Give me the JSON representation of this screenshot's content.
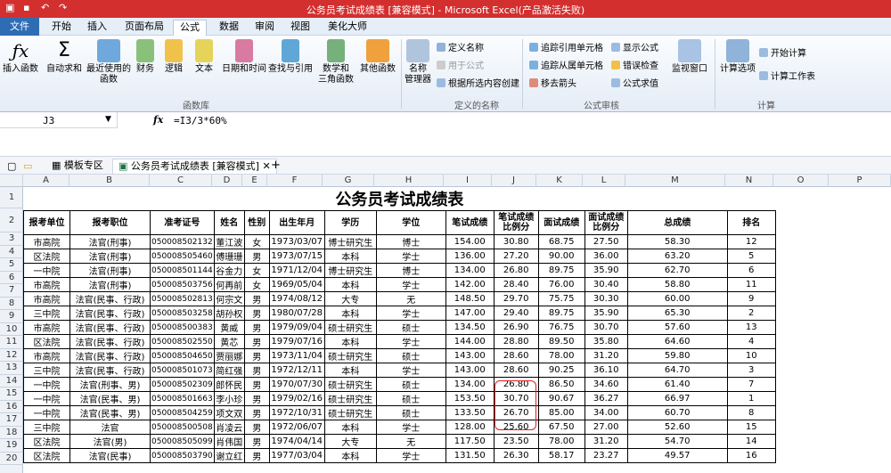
{
  "window": {
    "title": "公务员考试成绩表 [兼容模式] - Microsoft Excel(产品激活失败)"
  },
  "tabs": [
    "文件",
    "开始",
    "插入",
    "页面布局",
    "公式",
    "数据",
    "审阅",
    "视图",
    "美化大师"
  ],
  "ribbon": {
    "big": [
      "插入函数",
      "自动求和",
      "最近使用的\n函数",
      "财务",
      "逻辑",
      "文本",
      "日期和时间",
      "查找与引用",
      "数学和\n三角函数",
      "其他函数",
      "名称\n管理器",
      "监视窗口",
      "计算选项"
    ],
    "group_labels": [
      "函数库",
      "定义的名称",
      "公式审核",
      "计算"
    ],
    "small": [
      "定义名称",
      "用于公式",
      "根据所选内容创建",
      "追踪引用单元格",
      "追踪从属单元格",
      "移去箭头",
      "显示公式",
      "错误检查",
      "公式求值",
      "开始计算",
      "计算工作表"
    ]
  },
  "formula_bar": {
    "cell": "J3",
    "fx": "fx",
    "formula": "=I3/3*60%"
  },
  "doc_tabs": [
    "模板专区",
    "公务员考试成绩表 [兼容模式]"
  ],
  "columns": [
    "A",
    "B",
    "C",
    "D",
    "E",
    "F",
    "G",
    "H",
    "I",
    "J",
    "K",
    "L",
    "M",
    "N",
    "O",
    "P"
  ],
  "rows": [
    "1",
    "2",
    "3",
    "4",
    "5",
    "6",
    "7",
    "8",
    "9",
    "10",
    "11",
    "12",
    "13",
    "14",
    "15",
    "16",
    "17",
    "18",
    "19",
    "20"
  ],
  "sheet": {
    "title": "公务员考试成绩表",
    "headers": [
      "报考单位",
      "报考职位",
      "准考证号",
      "姓名",
      "性别",
      "出生年月",
      "学历",
      "学位",
      "笔试成绩",
      "笔试成绩比例分",
      "面试成绩",
      "面试成绩比例分",
      "总成绩",
      "排名"
    ],
    "data": [
      [
        "市高院",
        "法官(刑事)",
        "050008502132",
        "董江波",
        "女",
        "1973/03/07",
        "博士研究生",
        "博士",
        "154.00",
        "30.80",
        "68.75",
        "27.50",
        "58.30",
        "12"
      ],
      [
        "区法院",
        "法官(刑事)",
        "050008505460",
        "傅珊珊",
        "男",
        "1973/07/15",
        "本科",
        "学士",
        "136.00",
        "27.20",
        "90.00",
        "36.00",
        "63.20",
        "5"
      ],
      [
        "一中院",
        "法官(刑事)",
        "050008501144",
        "谷金力",
        "女",
        "1971/12/04",
        "博士研究生",
        "博士",
        "134.00",
        "26.80",
        "89.75",
        "35.90",
        "62.70",
        "6"
      ],
      [
        "市高院",
        "法官(刑事)",
        "050008503756",
        "何再前",
        "女",
        "1969/05/04",
        "本科",
        "学士",
        "142.00",
        "28.40",
        "76.00",
        "30.40",
        "58.80",
        "11"
      ],
      [
        "市高院",
        "法官(民事、行政)",
        "050008502813",
        "何宗文",
        "男",
        "1974/08/12",
        "大专",
        "无",
        "148.50",
        "29.70",
        "75.75",
        "30.30",
        "60.00",
        "9"
      ],
      [
        "三中院",
        "法官(民事、行政)",
        "050008503258",
        "胡孙权",
        "男",
        "1980/07/28",
        "本科",
        "学士",
        "147.00",
        "29.40",
        "89.75",
        "35.90",
        "65.30",
        "2"
      ],
      [
        "市高院",
        "法官(民事、行政)",
        "050008500383",
        "黄威",
        "男",
        "1979/09/04",
        "硕士研究生",
        "硕士",
        "134.50",
        "26.90",
        "76.75",
        "30.70",
        "57.60",
        "13"
      ],
      [
        "区法院",
        "法官(民事、行政)",
        "050008502550",
        "黄芯",
        "男",
        "1979/07/16",
        "本科",
        "学士",
        "144.00",
        "28.80",
        "89.50",
        "35.80",
        "64.60",
        "4"
      ],
      [
        "市高院",
        "法官(民事、行政)",
        "050008504650",
        "贾丽娜",
        "男",
        "1973/11/04",
        "硕士研究生",
        "硕士",
        "143.00",
        "28.60",
        "78.00",
        "31.20",
        "59.80",
        "10"
      ],
      [
        "三中院",
        "法官(民事、行政)",
        "050008501073",
        "简红强",
        "男",
        "1972/12/11",
        "本科",
        "学士",
        "143.00",
        "28.60",
        "90.25",
        "36.10",
        "64.70",
        "3"
      ],
      [
        "一中院",
        "法官(刑事、男)",
        "050008502309",
        "郎怀民",
        "男",
        "1970/07/30",
        "硕士研究生",
        "硕士",
        "134.00",
        "26.80",
        "86.50",
        "34.60",
        "61.40",
        "7"
      ],
      [
        "一中院",
        "法官(民事、男)",
        "050008501663",
        "李小珍",
        "男",
        "1979/02/16",
        "硕士研究生",
        "硕士",
        "153.50",
        "30.70",
        "90.67",
        "36.27",
        "66.97",
        "1"
      ],
      [
        "一中院",
        "法官(民事、男)",
        "050008504259",
        "项文双",
        "男",
        "1972/10/31",
        "硕士研究生",
        "硕士",
        "133.50",
        "26.70",
        "85.00",
        "34.00",
        "60.70",
        "8"
      ],
      [
        "三中院",
        "法官",
        "050008500508",
        "肖凌云",
        "男",
        "1972/06/07",
        "本科",
        "学士",
        "128.00",
        "25.60",
        "67.50",
        "27.00",
        "52.60",
        "15"
      ],
      [
        "区法院",
        "法官(男)",
        "050008505099",
        "肖伟国",
        "男",
        "1974/04/14",
        "大专",
        "无",
        "117.50",
        "23.50",
        "78.00",
        "31.20",
        "54.70",
        "14"
      ],
      [
        "区法院",
        "法官(民事)",
        "050008503790",
        "谢立红",
        "男",
        "1977/03/04",
        "本科",
        "学士",
        "131.50",
        "26.30",
        "58.17",
        "23.27",
        "49.57",
        "16"
      ]
    ]
  },
  "colors": {
    "titlebar": "#d32f2f",
    "file_tab": "#2e6db4",
    "selection": "#e02020"
  }
}
